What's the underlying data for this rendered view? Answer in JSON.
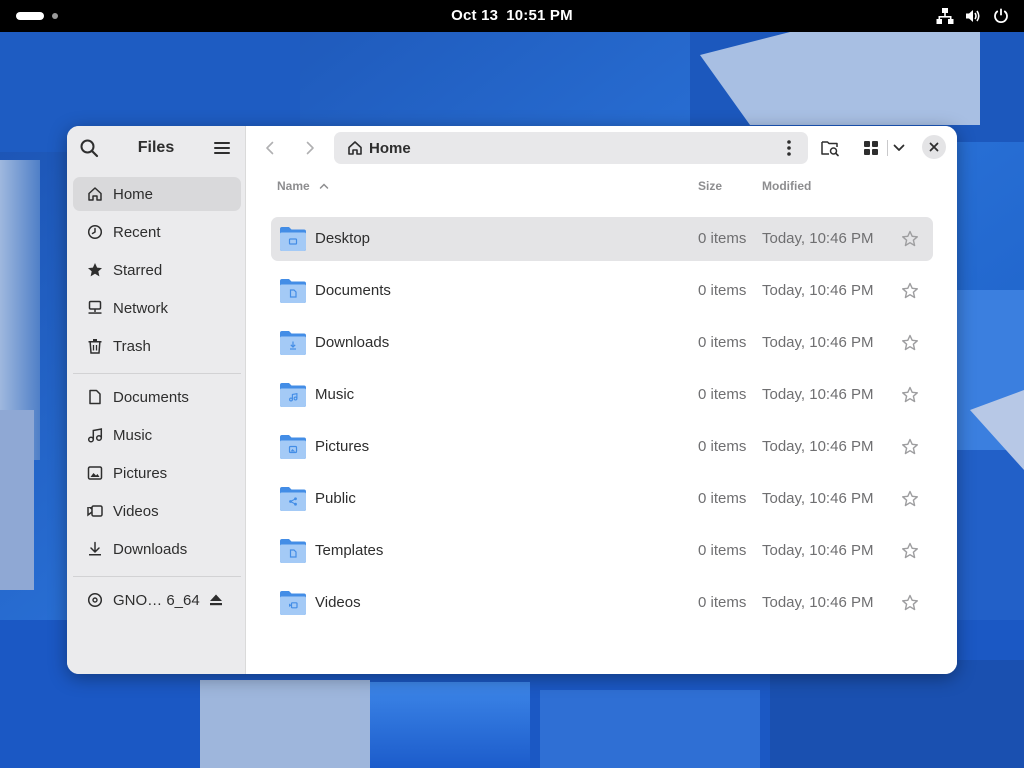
{
  "topbar": {
    "date": "Oct 13",
    "time": "10:51 PM"
  },
  "window": {
    "app_title": "Files",
    "sidebar": {
      "places": [
        {
          "label": "Home",
          "icon": "home-icon",
          "active": true
        },
        {
          "label": "Recent",
          "icon": "clock-icon"
        },
        {
          "label": "Starred",
          "icon": "star-icon"
        },
        {
          "label": "Network",
          "icon": "network-icon"
        },
        {
          "label": "Trash",
          "icon": "trash-icon"
        }
      ],
      "bookmarks": [
        {
          "label": "Documents",
          "icon": "document-icon"
        },
        {
          "label": "Music",
          "icon": "music-icon"
        },
        {
          "label": "Pictures",
          "icon": "picture-icon"
        },
        {
          "label": "Videos",
          "icon": "video-icon"
        },
        {
          "label": "Downloads",
          "icon": "download-icon"
        }
      ],
      "devices": [
        {
          "label": "GNO… 6_64",
          "icon": "disc-icon"
        }
      ]
    },
    "pathbar": {
      "location": "Home"
    },
    "columns": {
      "name": "Name",
      "size": "Size",
      "modified": "Modified"
    },
    "files": [
      {
        "name": "Desktop",
        "size": "0 items",
        "modified": "Today, 10:46 PM",
        "selected": true,
        "emblem": "desktop"
      },
      {
        "name": "Documents",
        "size": "0 items",
        "modified": "Today, 10:46 PM",
        "emblem": "document"
      },
      {
        "name": "Downloads",
        "size": "0 items",
        "modified": "Today, 10:46 PM",
        "emblem": "download"
      },
      {
        "name": "Music",
        "size": "0 items",
        "modified": "Today, 10:46 PM",
        "emblem": "music"
      },
      {
        "name": "Pictures",
        "size": "0 items",
        "modified": "Today, 10:46 PM",
        "emblem": "picture"
      },
      {
        "name": "Public",
        "size": "0 items",
        "modified": "Today, 10:46 PM",
        "emblem": "share"
      },
      {
        "name": "Templates",
        "size": "0 items",
        "modified": "Today, 10:46 PM",
        "emblem": "document"
      },
      {
        "name": "Videos",
        "size": "0 items",
        "modified": "Today, 10:46 PM",
        "emblem": "video"
      }
    ],
    "colors": {
      "accent": "#3584e4",
      "folder_back": "#438de6",
      "folder_front": "#a4caf6",
      "sidebar_bg": "#ebebed"
    }
  }
}
